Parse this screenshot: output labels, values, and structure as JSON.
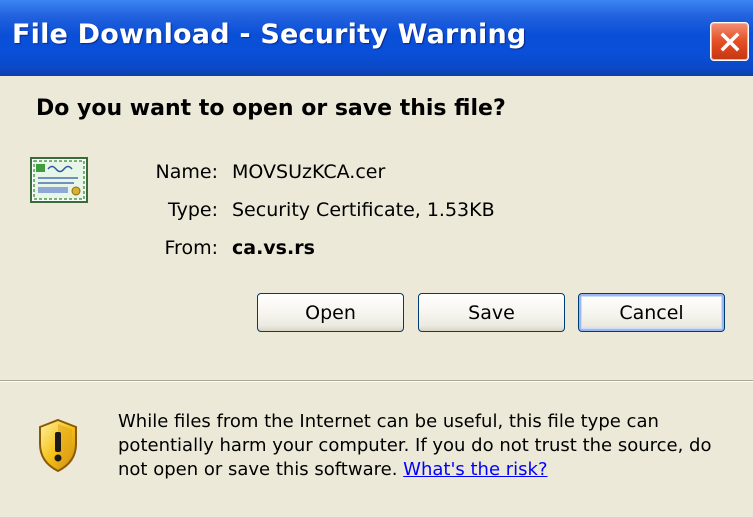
{
  "window": {
    "title": "File Download - Security Warning",
    "close_label": "Close"
  },
  "dialog": {
    "question": "Do you want to open or save this file?",
    "file": {
      "name_label": "Name:",
      "name_value": "MOVSUzKCA.cer",
      "type_label": "Type:",
      "type_value": "Security Certificate, 1.53KB",
      "from_label": "From:",
      "from_value": "ca.vs.rs"
    },
    "buttons": {
      "open": "Open",
      "save": "Save",
      "cancel": "Cancel"
    },
    "warning": {
      "text": "While files from the Internet can be useful, this file type can potentially harm your computer. If you do not trust the source, do not open or save this software. ",
      "link": "What's the risk?"
    }
  },
  "icons": {
    "file_icon": "certificate-icon",
    "warning_icon": "shield-warning-icon",
    "close_icon": "close-icon"
  },
  "colors": {
    "titlebar": "#0a4fd8",
    "dialog_bg": "#ece9d8",
    "close_button": "#e5542a",
    "link": "#0000ff"
  }
}
